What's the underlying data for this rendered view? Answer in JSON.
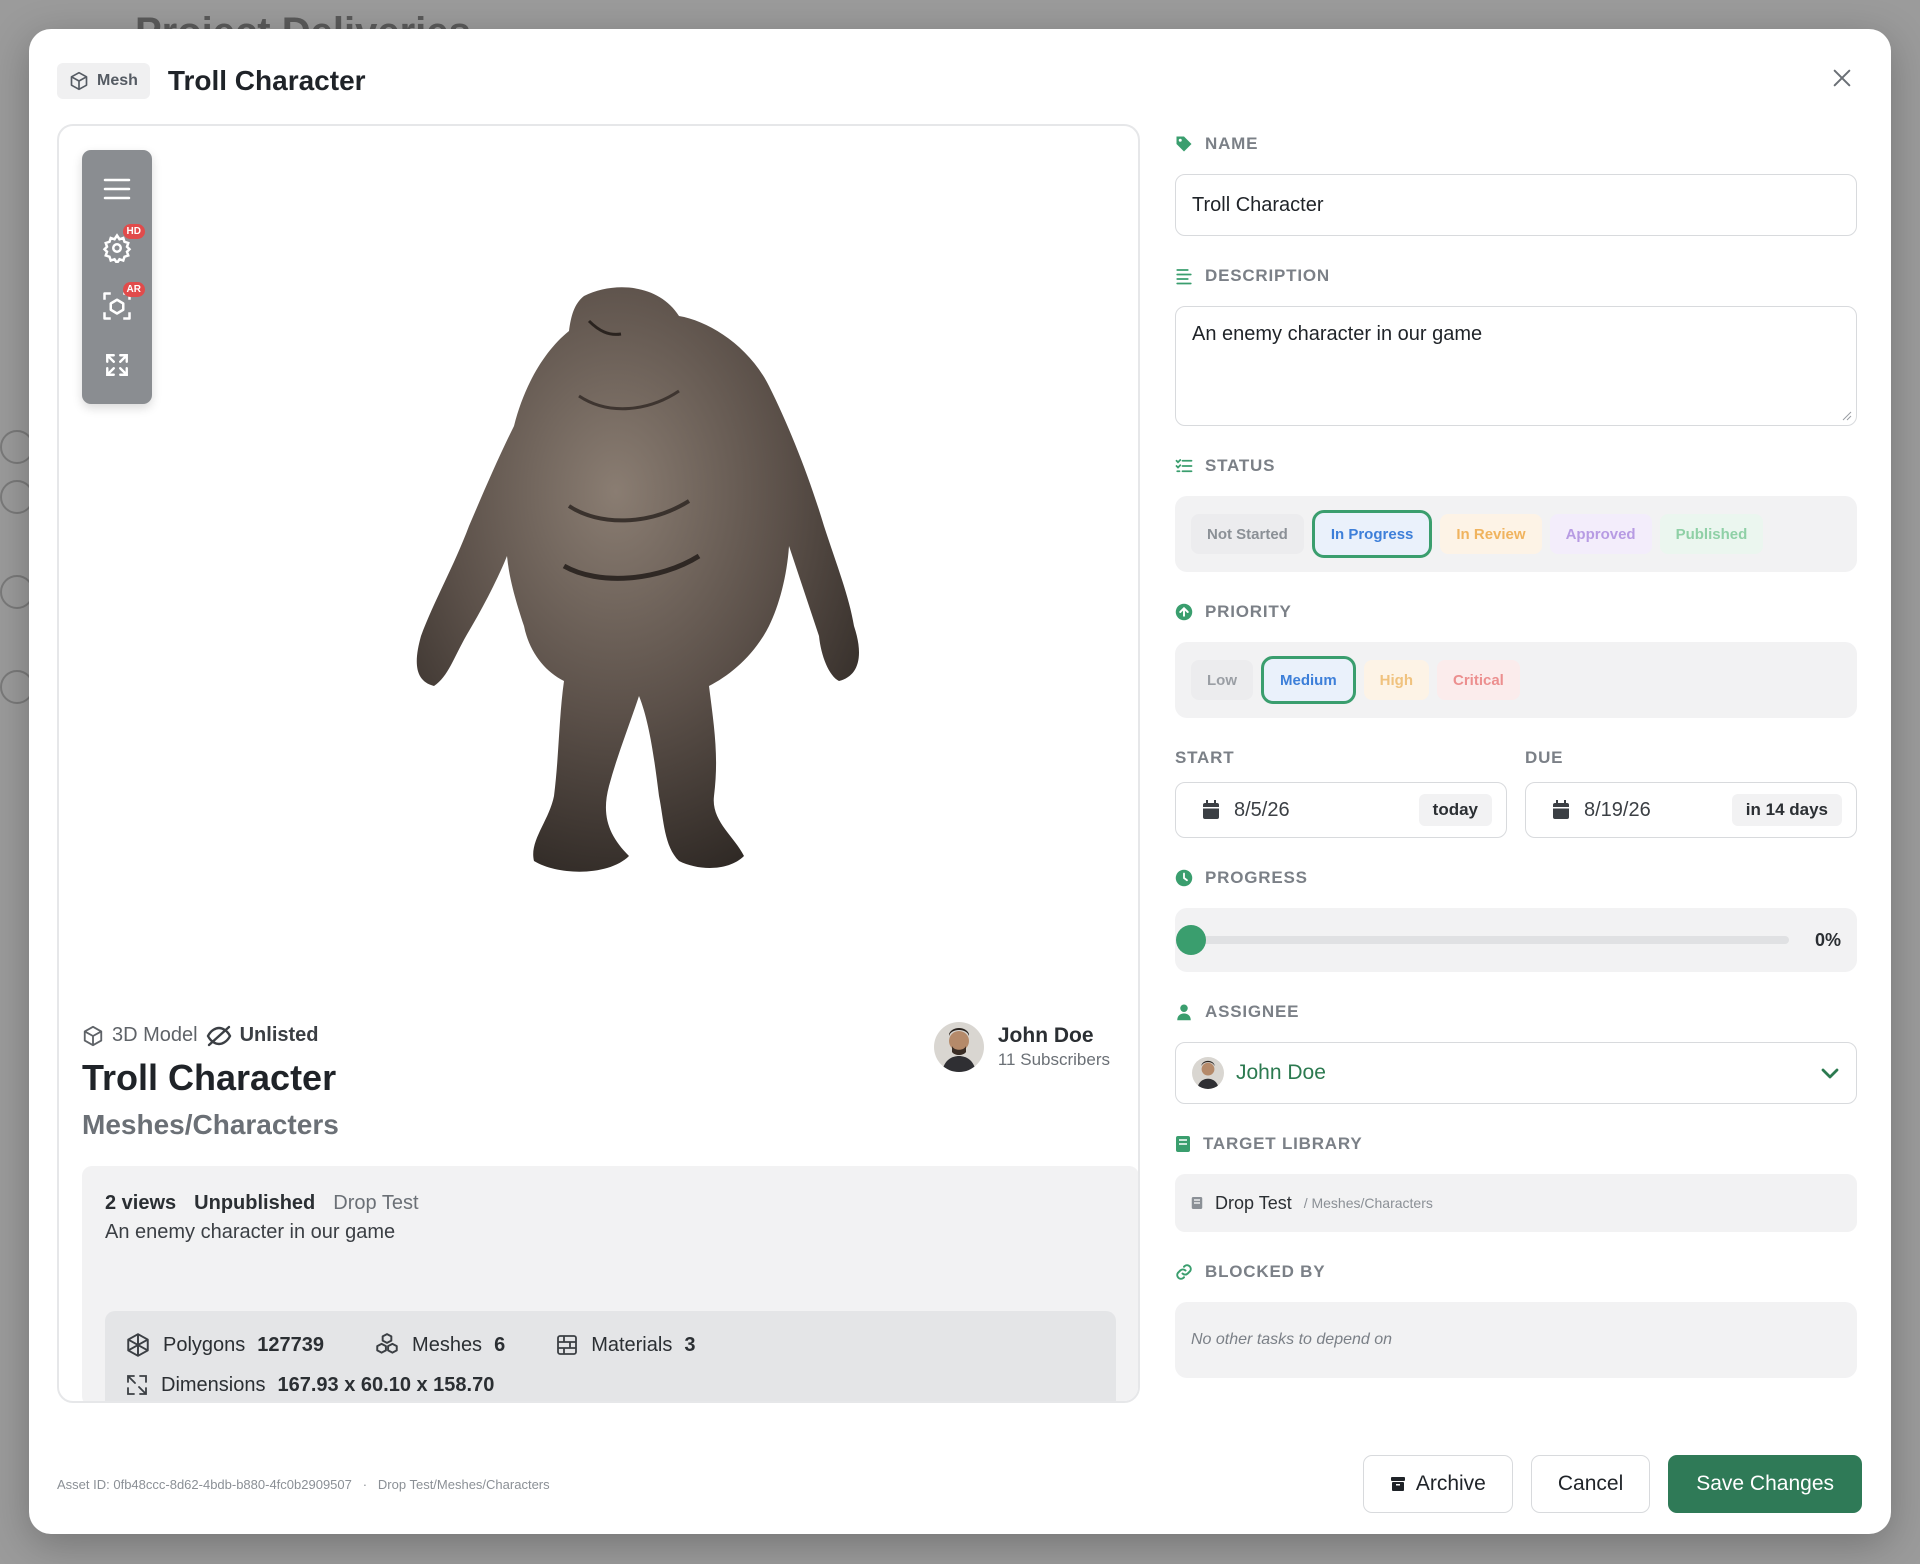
{
  "background": {
    "title": "Project Deliveries"
  },
  "header": {
    "type_label": "Mesh",
    "title": "Troll Character"
  },
  "viewer": {
    "toolbar": [
      {
        "name": "menu-icon"
      },
      {
        "name": "settings-icon",
        "badge": "HD"
      },
      {
        "name": "ar-icon",
        "badge": "AR"
      },
      {
        "name": "fullscreen-icon"
      }
    ],
    "asset_kind": "3D Model",
    "visibility": "Unlisted",
    "title": "Troll Character",
    "path": "Meshes/Characters",
    "author": {
      "name": "John Doe",
      "subscribers": "11 Subscribers"
    },
    "info": {
      "views": "2 views",
      "publish_state": "Unpublished",
      "library": "Drop Test",
      "description": "An enemy character in our game"
    },
    "stats": {
      "polygons_label": "Polygons",
      "polygons": "127739",
      "meshes_label": "Meshes",
      "meshes": "6",
      "materials_label": "Materials",
      "materials": "3",
      "dimensions_label": "Dimensions",
      "dimensions": "167.93 x 60.10 x 158.70"
    }
  },
  "form": {
    "name_label": "NAME",
    "name_value": "Troll Character",
    "description_label": "DESCRIPTION",
    "description_value": "An enemy character in our game",
    "status_label": "STATUS",
    "status_options": [
      {
        "label": "Not Started",
        "color": "#8b9096",
        "bg": "#ececee",
        "selected": false
      },
      {
        "label": "In Progress",
        "color": "#3d7fd9",
        "bg": "#eaf1fb",
        "selected": true
      },
      {
        "label": "In Review",
        "color": "#f0b35e",
        "bg": "#fdf3e6",
        "selected": false
      },
      {
        "label": "Approved",
        "color": "#b79be3",
        "bg": "#f3edfb",
        "selected": false
      },
      {
        "label": "Published",
        "color": "#8fd0a6",
        "bg": "#ebf6ef",
        "selected": false
      }
    ],
    "priority_label": "PRIORITY",
    "priority_options": [
      {
        "label": "Low",
        "color": "#9a9ea4",
        "bg": "#ececee",
        "selected": false
      },
      {
        "label": "Medium",
        "color": "#3d7fd9",
        "bg": "#eaf1fb",
        "selected": true
      },
      {
        "label": "High",
        "color": "#f0c27e",
        "bg": "#fdf3e6",
        "selected": false
      },
      {
        "label": "Critical",
        "color": "#ec8f8f",
        "bg": "#fbecec",
        "selected": false
      }
    ],
    "start_label": "START",
    "start_value": "8/5/26",
    "start_tag": "today",
    "due_label": "DUE",
    "due_value": "8/19/26",
    "due_tag": "in 14 days",
    "progress_label": "PROGRESS",
    "progress_value": "0%",
    "progress_fraction": 0,
    "assignee_label": "ASSIGNEE",
    "assignee_value": "John Doe",
    "library_label": "TARGET LIBRARY",
    "library_name": "Drop Test",
    "library_path": "/ Meshes/Characters",
    "blocked_label": "BLOCKED BY",
    "blocked_placeholder": "No other tasks to depend on"
  },
  "footer": {
    "asset_id": "Asset ID: 0fb48ccc-8d62-4bdb-b880-4fc0b2909507",
    "separator": "·",
    "asset_path": "Drop Test/Meshes/Characters",
    "archive_label": "Archive",
    "cancel_label": "Cancel",
    "save_label": "Save Changes"
  },
  "colors": {
    "accent": "#2f7a57",
    "accent_light": "#3a9e6e"
  }
}
